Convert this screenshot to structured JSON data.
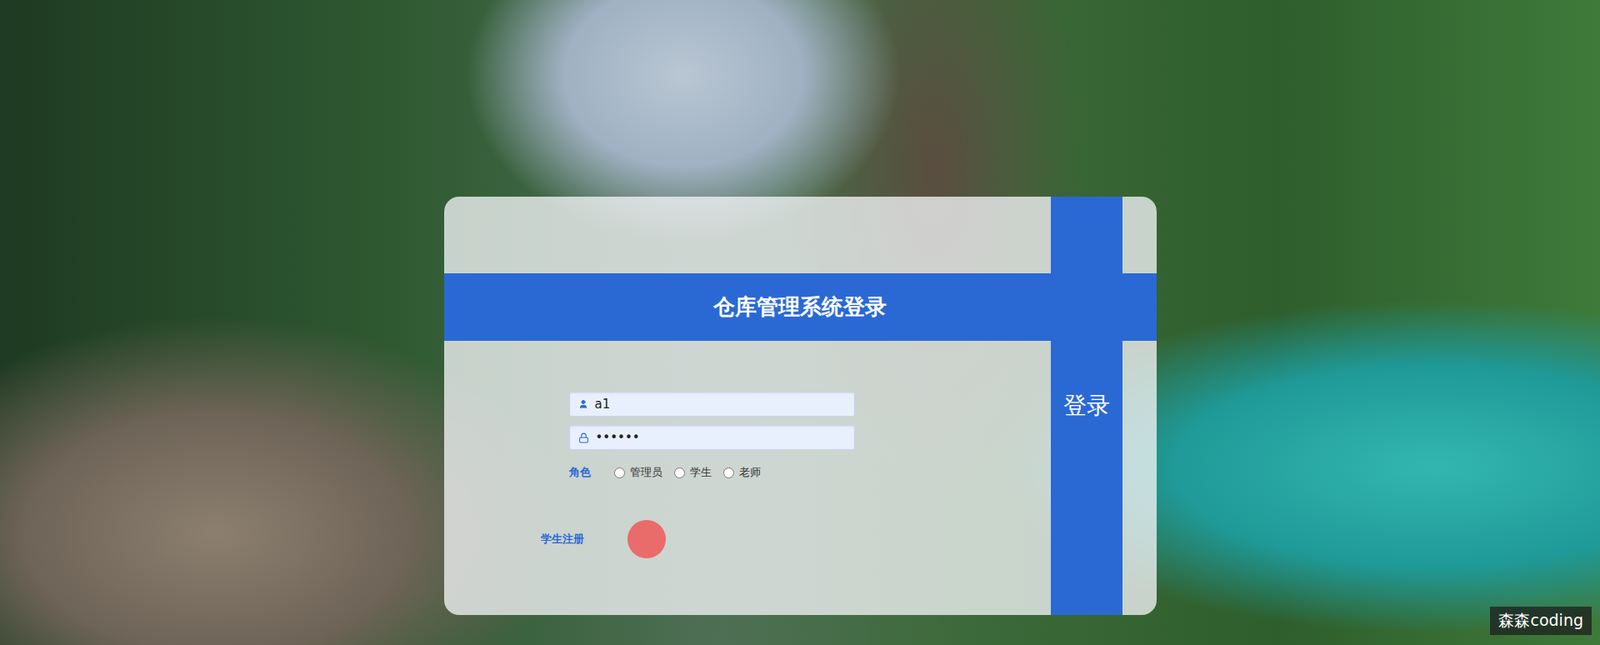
{
  "title": "仓库管理系统登录",
  "fields": [
    {
      "kind": "username",
      "value": "a1"
    },
    {
      "kind": "password",
      "value": "••••••"
    }
  ],
  "role": {
    "label": "角色",
    "options": [
      {
        "label": "管理员",
        "selected": false
      },
      {
        "label": "学生",
        "selected": false
      },
      {
        "label": "老师",
        "selected": false
      }
    ]
  },
  "links": [
    "学生注册"
  ],
  "buttons": [
    "登录"
  ],
  "watermark": "森森coding"
}
